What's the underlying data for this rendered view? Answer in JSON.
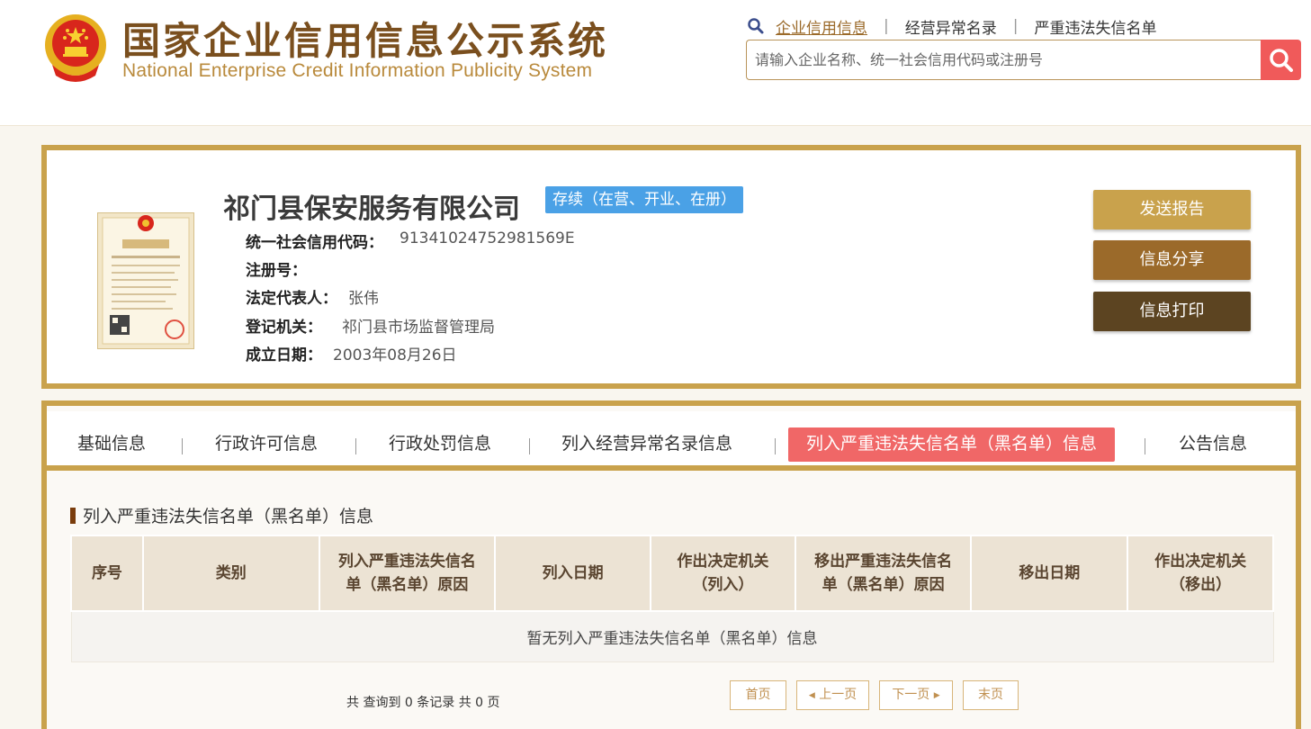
{
  "header": {
    "title": "国家企业信用信息公示系统",
    "subtitle": "National Enterprise Credit Information Publicity System",
    "links": [
      {
        "label": "企业信用信息",
        "active": true
      },
      {
        "label": "经营异常名录",
        "active": false
      },
      {
        "label": "严重违法失信名单",
        "active": false
      }
    ],
    "search_placeholder": "请输入企业名称、统一社会信用代码或注册号"
  },
  "company": {
    "name": "祁门县保安服务有限公司",
    "status": "存续（在营、开业、在册）",
    "fields": [
      {
        "label": "统一社会信用代码：",
        "value": "91341024752981569E"
      },
      {
        "label": "注册号：",
        "value": ""
      },
      {
        "label": "法定代表人：",
        "value": "张伟"
      },
      {
        "label": "登记机关：",
        "value": "祁门县市场监督管理局"
      },
      {
        "label": "成立日期：",
        "value": "2003年08月26日"
      }
    ],
    "actions": [
      {
        "label": "发送报告",
        "color": "#c9a24c"
      },
      {
        "label": "信息分享",
        "color": "#9b6a2a"
      },
      {
        "label": "信息打印",
        "color": "#5c4421"
      }
    ]
  },
  "tabs": [
    {
      "label": "基础信息",
      "active": false
    },
    {
      "label": "行政许可信息",
      "active": false
    },
    {
      "label": "行政处罚信息",
      "active": false
    },
    {
      "label": "列入经营异常名录信息",
      "active": false
    },
    {
      "label": "列入严重违法失信名单（黑名单）信息",
      "active": true
    },
    {
      "label": "公告信息",
      "active": false
    }
  ],
  "section": {
    "title": "列入严重违法失信名单（黑名单）信息",
    "columns": [
      [
        "序号"
      ],
      [
        "类别"
      ],
      [
        "列入严重违法失信名",
        "单（黑名单）原因"
      ],
      [
        "列入日期"
      ],
      [
        "作出决定机关",
        "（列入）"
      ],
      [
        "移出严重违法失信名",
        "单（黑名单）原因"
      ],
      [
        "移出日期"
      ],
      [
        "作出决定机关",
        "（移出）"
      ]
    ],
    "empty_text": "暂无列入严重违法失信名单（黑名单）信息",
    "summary": "共 查询到 0 条记录 共 0 页"
  },
  "pagination": {
    "first": "首页",
    "prev": "上一页",
    "next": "下一页",
    "last": "末页"
  },
  "colors": {
    "gold_border": "#c9a24c",
    "accent_red": "#f06767",
    "status_blue": "#4aa1e6"
  }
}
